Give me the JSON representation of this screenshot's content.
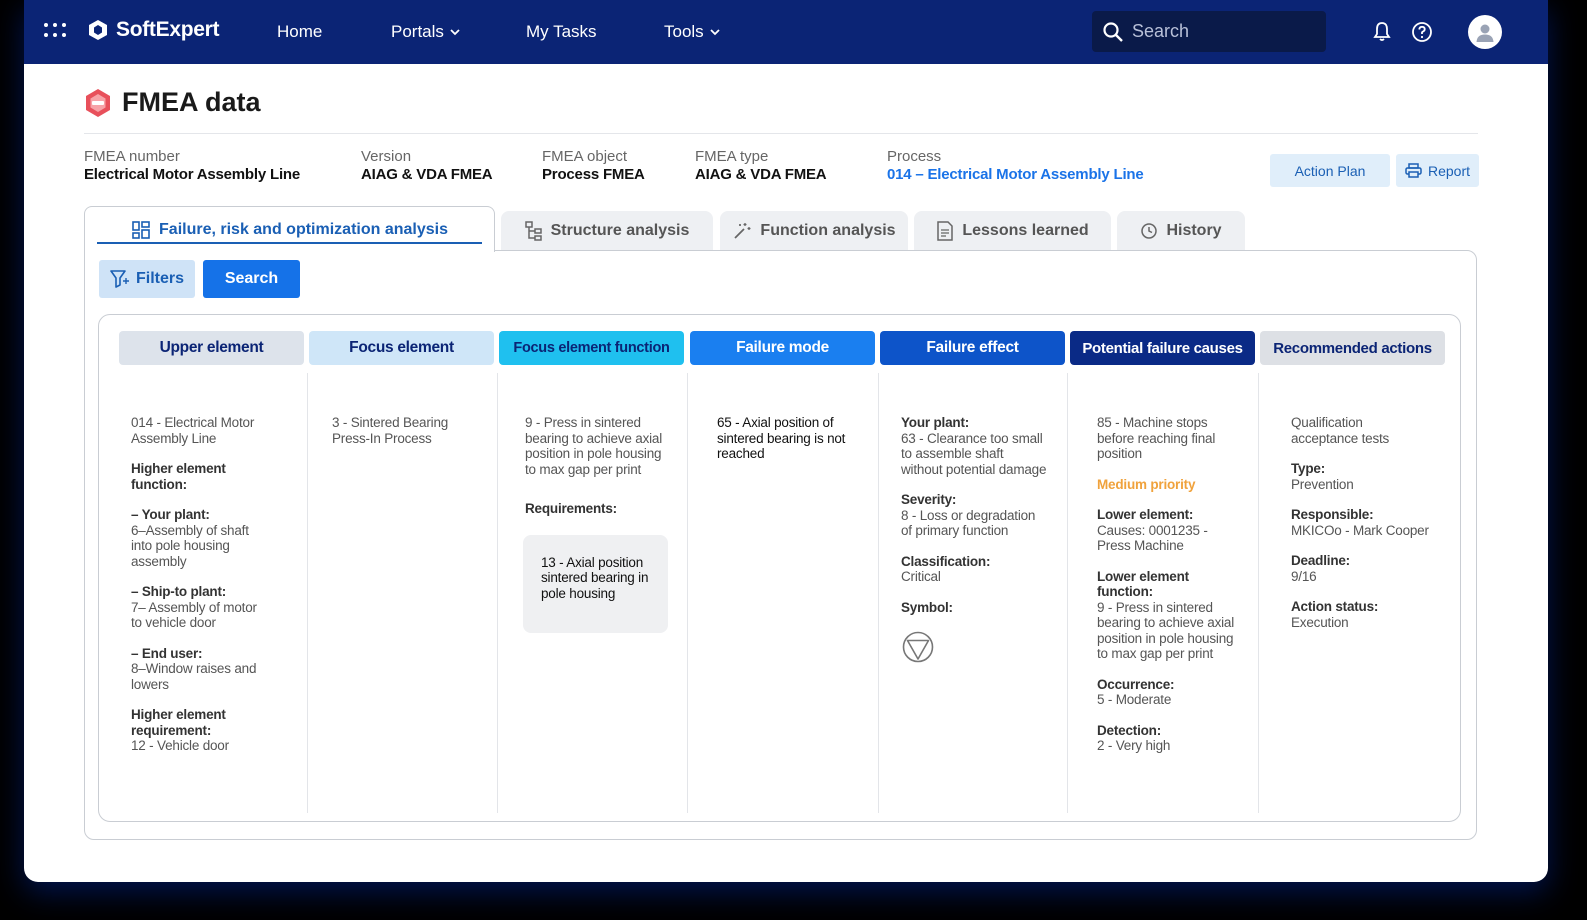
{
  "nav": {
    "brand": "SoftExpert",
    "items": [
      {
        "label": "Home"
      },
      {
        "label": "Portals"
      },
      {
        "label": "My Tasks"
      },
      {
        "label": "Tools"
      }
    ],
    "search_placeholder": "Search"
  },
  "page": {
    "title": "FMEA data"
  },
  "meta": {
    "fmea_number": {
      "label": "FMEA number",
      "value": "Electrical Motor Assembly Line"
    },
    "version": {
      "label": "Version",
      "value": "AIAG & VDA FMEA"
    },
    "fmea_object": {
      "label": "FMEA object",
      "value": "Process FMEA"
    },
    "fmea_type": {
      "label": "FMEA type",
      "value": "AIAG & VDA FMEA"
    },
    "process": {
      "label": "Process",
      "value": "014 – Electrical Motor Assembly Line"
    }
  },
  "actions": {
    "action_plan": "Action Plan",
    "report": "Report"
  },
  "tabs": [
    {
      "label": "Failure, risk and optimization analysis"
    },
    {
      "label": "Structure analysis"
    },
    {
      "label": "Function analysis"
    },
    {
      "label": "Lessons learned"
    },
    {
      "label": "History"
    }
  ],
  "toolbar": {
    "filters": "Filters",
    "search": "Search"
  },
  "columns": {
    "upper_element": {
      "header": "Upper element",
      "value": "014 - Electrical Motor Assembly Line",
      "higher_function_label": "Higher element function:",
      "your_plant_label": "– Your plant:",
      "your_plant_value": "6–Assembly of shaft into pole housing assembly",
      "ship_to_label": "– Ship-to plant:",
      "ship_to_value": "7– Assembly of motor to vehicle door",
      "end_user_label": "– End user:",
      "end_user_value": "8–Window raises and lowers",
      "higher_req_label": "Higher element requirement:",
      "higher_req_value": "12 - Vehicle door"
    },
    "focus_element": {
      "header": "Focus element",
      "value": "3 - Sintered Bearing Press-In Process"
    },
    "focus_function": {
      "header": "Focus element function",
      "value": "9 - Press in sintered bearing to achieve axial position in pole housing to max gap per print",
      "requirements_label": "Requirements:",
      "requirement_value": "13 - Axial position sintered bearing in pole housing"
    },
    "failure_mode": {
      "header": "Failure mode",
      "value": "65 - Axial position of sintered bearing is not reached"
    },
    "failure_effect": {
      "header": "Failure effect",
      "your_plant_label": "Your plant:",
      "your_plant_value": "63 - Clearance too small to assemble shaft without potential damage",
      "severity_label": "Severity:",
      "severity_value": "8 - Loss or degradation of primary function",
      "classification_label": "Classification:",
      "classification_value": "Critical",
      "symbol_label": "Symbol:"
    },
    "failure_causes": {
      "header": "Potential failure causes",
      "value": "85 - Machine stops before reaching final position",
      "priority": "Medium priority",
      "lower_element_label": "Lower element:",
      "lower_element_value": "Causes: 0001235 - Press Machine",
      "lower_function_label": "Lower element function:",
      "lower_function_value": "9 - Press in sintered bearing to achieve axial position in pole housing to max gap per print",
      "occurrence_label": "Occurrence:",
      "occurrence_value": "5 - Moderate",
      "detection_label": "Detection:",
      "detection_value": "2 - Very high"
    },
    "recommended_actions": {
      "header": "Recommended actions",
      "value": "Qualification acceptance tests",
      "type_label": "Type:",
      "type_value": "Prevention",
      "responsible_label": "Responsible:",
      "responsible_value": "MKICOo - Mark Cooper",
      "deadline_label": "Deadline:",
      "deadline_value": "9/16",
      "status_label": "Action status:",
      "status_value": "Execution"
    }
  },
  "colors": {
    "nav_bg": "#0b2475",
    "header_upper": "#dde3eb",
    "header_focus": "#cfe6f8",
    "header_function": "#1fc0ef",
    "header_failure_mode": "#1a7ff0",
    "header_failure_effect": "#0d54c9",
    "header_causes": "#0a2a86",
    "header_recommended": "#dde0e5",
    "priority_medium": "#f0a23c"
  }
}
